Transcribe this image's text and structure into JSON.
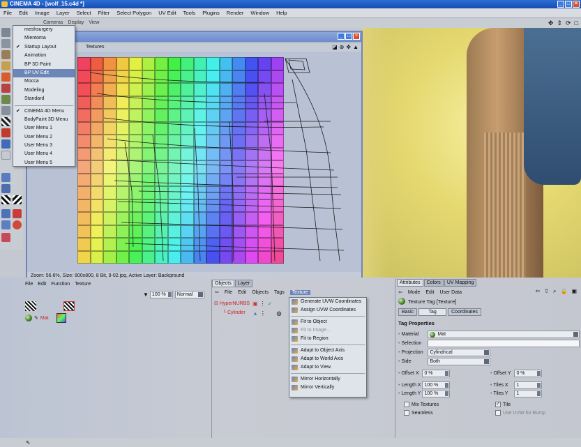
{
  "window": {
    "title": "CINEMA 4D - [wolf_15.c4d *]"
  },
  "menubar": [
    "File",
    "Edit",
    "Image",
    "Layer",
    "Select",
    "Filter",
    "Select Polygon",
    "UV Edit",
    "Tools",
    "Plugins",
    "Render",
    "Window",
    "Help"
  ],
  "view_menu": [
    "Cameras",
    "Display",
    "View"
  ],
  "layout_menu": {
    "items": [
      {
        "label": "meshsurgery",
        "checked": false,
        "selected": false
      },
      {
        "label": "Mientoma",
        "checked": false,
        "selected": false
      },
      {
        "label": "Startup Layout",
        "checked": true,
        "selected": false
      },
      {
        "label": "Animation",
        "checked": false,
        "selected": false
      },
      {
        "label": "BP 3D Paint",
        "checked": false,
        "selected": false
      },
      {
        "label": "BP UV Edit",
        "checked": false,
        "selected": true
      },
      {
        "label": "Mocca",
        "checked": false,
        "selected": false
      },
      {
        "label": "Modeling",
        "checked": false,
        "selected": false
      },
      {
        "label": "Standard",
        "checked": false,
        "selected": false
      }
    ],
    "items2": [
      {
        "label": "CINEMA 4D Menu",
        "checked": true
      },
      {
        "label": "BodyPaint 3D Menu",
        "checked": false
      },
      {
        "label": "User Menu 1",
        "checked": false
      },
      {
        "label": "User Menu 2",
        "checked": false
      },
      {
        "label": "User Menu 3",
        "checked": false
      },
      {
        "label": "User Menu 4",
        "checked": false
      },
      {
        "label": "User Menu 5",
        "checked": false
      }
    ]
  },
  "texture_window": {
    "menu_label": "Textures",
    "status": "Zoom: 56.6%, Size: 800x800, 8 Bit, 9-02.jpg, Active Layer: Background"
  },
  "material_panel": {
    "menu": [
      "File",
      "Edit",
      "Function",
      "Texture"
    ],
    "opacity": "100 %",
    "blend_mode": "Normal",
    "material_label": "Mat"
  },
  "objects_panel": {
    "tabs": [
      "Objects",
      "Layer"
    ],
    "menu": [
      "File",
      "Edit",
      "Objects",
      "Tags",
      "Texture"
    ],
    "menu_active": "Texture",
    "objects": [
      {
        "name": "HyperNURBS",
        "color": "#c81e1e"
      },
      {
        "name": "Cylinder",
        "color": "#c81e1e"
      }
    ]
  },
  "texture_menu": {
    "groups": [
      [
        {
          "label": "Generate UVW Coordinates",
          "enabled": true
        },
        {
          "label": "Assign UVW Coordinates",
          "enabled": true
        }
      ],
      [
        {
          "label": "Fit to Object",
          "enabled": true
        },
        {
          "label": "Fit to Image...",
          "enabled": false
        },
        {
          "label": "Fit to Region",
          "enabled": true
        }
      ],
      [
        {
          "label": "Adapt to Object Axis",
          "enabled": true
        },
        {
          "label": "Adapt to World Axis",
          "enabled": true
        },
        {
          "label": "Adapt to View",
          "enabled": true
        }
      ],
      [
        {
          "label": "Mirror Horizontally",
          "enabled": true
        },
        {
          "label": "Mirror Vertically",
          "enabled": true
        }
      ]
    ]
  },
  "attributes_panel": {
    "tabs": [
      "Attributes",
      "Colors",
      "UV Mapping"
    ],
    "menu": [
      "Mode",
      "Edit",
      "User Data"
    ],
    "title": "Texture Tag [Texture]",
    "subtabs": [
      "Basic",
      "Tag",
      "Coordinates"
    ],
    "active_subtab": "Tag",
    "section": "Tag Properties",
    "material": {
      "label": "Material",
      "value": "Mat"
    },
    "selection": {
      "label": "Selection",
      "value": ""
    },
    "projection": {
      "label": "Projection",
      "value": "Cylindrical"
    },
    "side": {
      "label": "Side",
      "value": "Both"
    },
    "offset_x": {
      "label": "Offset X",
      "value": "0 %"
    },
    "offset_y": {
      "label": "Offset Y",
      "value": "0 %"
    },
    "length_x": {
      "label": "Length X",
      "value": "100 %"
    },
    "length_y": {
      "label": "Length Y",
      "value": "100 %"
    },
    "tiles_x": {
      "label": "Tiles X",
      "value": "1"
    },
    "tiles_y": {
      "label": "Tiles Y",
      "value": "1"
    },
    "mix_textures": {
      "label": "Mix Textures",
      "checked": false
    },
    "tile": {
      "label": "Tile",
      "checked": true
    },
    "seamless": {
      "label": "Seamless",
      "checked": false
    },
    "use_uvw_bump": {
      "label": "Use UVW for Bump",
      "checked": false
    }
  }
}
